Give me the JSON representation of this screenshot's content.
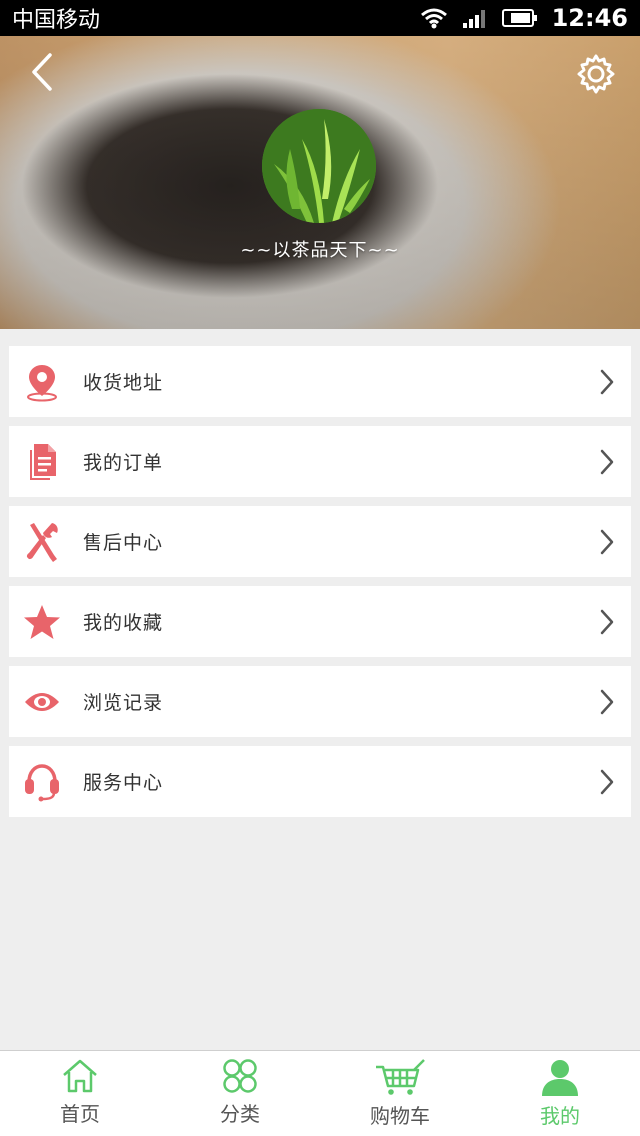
{
  "status_bar": {
    "carrier": "中国移动",
    "time": "12:46"
  },
  "header": {
    "slogan": "~~以茶品天下~~"
  },
  "menu": {
    "items": [
      {
        "label": "收货地址",
        "icon": "location-pin-icon"
      },
      {
        "label": "我的订单",
        "icon": "document-icon"
      },
      {
        "label": "售后中心",
        "icon": "tools-icon"
      },
      {
        "label": "我的收藏",
        "icon": "star-icon"
      },
      {
        "label": "浏览记录",
        "icon": "eye-icon"
      },
      {
        "label": "服务中心",
        "icon": "headset-icon"
      }
    ]
  },
  "tabbar": {
    "tabs": [
      {
        "label": "首页",
        "icon": "home-icon"
      },
      {
        "label": "分类",
        "icon": "category-icon"
      },
      {
        "label": "购物车",
        "icon": "cart-icon"
      },
      {
        "label": "我的",
        "icon": "user-icon",
        "active": true
      }
    ]
  },
  "colors": {
    "accent_green": "#5cc96b",
    "icon_red": "#e8646a"
  }
}
